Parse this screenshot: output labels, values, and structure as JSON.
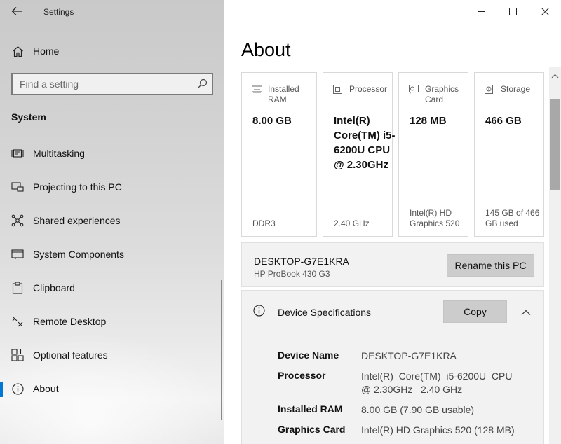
{
  "window": {
    "title": "Settings"
  },
  "sidebar": {
    "home_label": "Home",
    "search_placeholder": "Find a setting",
    "section_title": "System",
    "items": [
      {
        "label": "Multitasking"
      },
      {
        "label": "Projecting to this PC"
      },
      {
        "label": "Shared experiences"
      },
      {
        "label": "System Components"
      },
      {
        "label": "Clipboard"
      },
      {
        "label": "Remote Desktop"
      },
      {
        "label": "Optional features"
      },
      {
        "label": "About",
        "active": true
      }
    ]
  },
  "main": {
    "title": "About",
    "cards": [
      {
        "icon": "ram-icon",
        "title": "Installed RAM",
        "value": "8.00 GB",
        "footer": "DDR3"
      },
      {
        "icon": "processor-icon",
        "title": "Processor",
        "value": "Intel(R) Core(TM) i5-6200U CPU @ 2.30GHz",
        "footer": "2.40 GHz"
      },
      {
        "icon": "graphics-card-icon",
        "title": "Graphics Card",
        "value": "128 MB",
        "footer": "Intel(R) HD Graphics 520"
      },
      {
        "icon": "storage-icon",
        "title": "Storage",
        "value": "466 GB",
        "footer": "145 GB of 466 GB used"
      }
    ],
    "pc": {
      "name": "DESKTOP-G7E1KRA",
      "model": "HP ProBook 430 G3",
      "rename_label": "Rename this PC"
    },
    "specs": {
      "title": "Device Specifications",
      "copy_label": "Copy",
      "rows": [
        {
          "key": "Device Name",
          "value": "DESKTOP-G7E1KRA"
        },
        {
          "key": "Processor",
          "value": "Intel(R)  Core(TM)  i5-6200U  CPU  @ 2.30GHz   2.40 GHz"
        },
        {
          "key": "Installed RAM",
          "value": "8.00 GB (7.90 GB usable)"
        },
        {
          "key": "Graphics Card",
          "value": "Intel(R) HD Graphics 520 (128 MB)"
        }
      ]
    }
  }
}
